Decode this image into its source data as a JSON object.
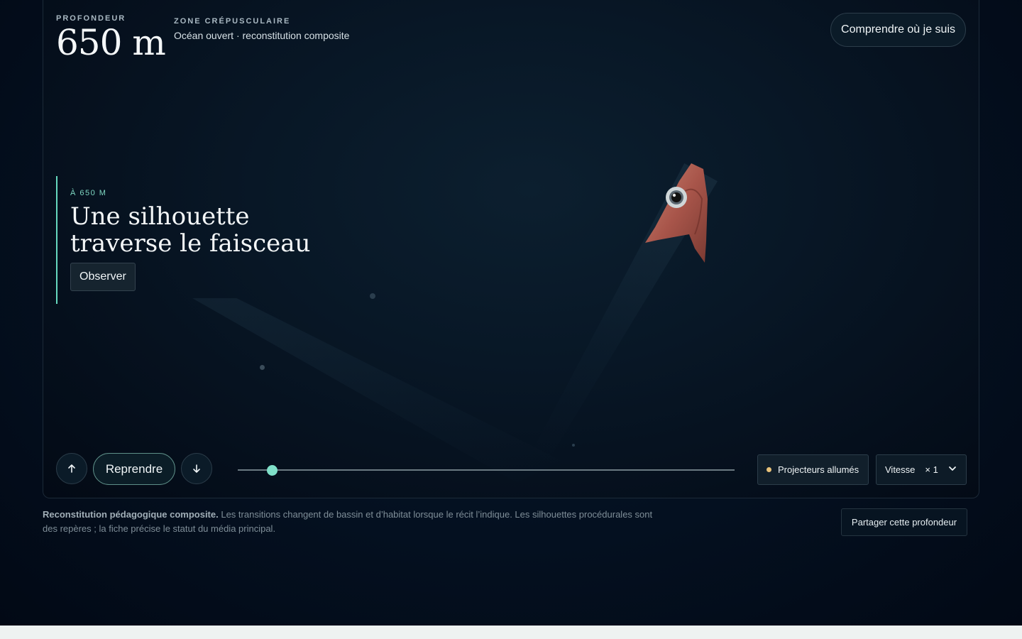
{
  "header": {
    "depth_label": "PROFONDEUR",
    "depth_value": "650 m",
    "zone_label": "ZONE CRÉPUSCULAIRE",
    "zone_subtitle": "Océan ouvert · reconstitution composite",
    "understand_button": "Comprendre où je suis"
  },
  "story": {
    "kicker": "À 650 M",
    "title": "Une silhouette traverse le faisceau",
    "observe_button": "Observer"
  },
  "controls": {
    "up_icon": "arrow-up-icon",
    "resume_button": "Reprendre",
    "down_icon": "arrow-down-icon",
    "progress": 0.068,
    "projectors_label": "Projecteurs allumés",
    "speed_label": "Vitesse",
    "speed_value": "× 1"
  },
  "footer": {
    "note_bold": "Reconstitution pédagogique composite.",
    "note_text": " Les transitions changent de bassin et d’habitat lorsque le récit l’indique. Les silhouettes procédurales sont des repères ; la fiche précise le statut du média principal.",
    "share_button": "Partager cette profondeur"
  },
  "colors": {
    "accent": "#7fe0c9",
    "background": "#041020",
    "projector_dot": "#e8c27a"
  }
}
